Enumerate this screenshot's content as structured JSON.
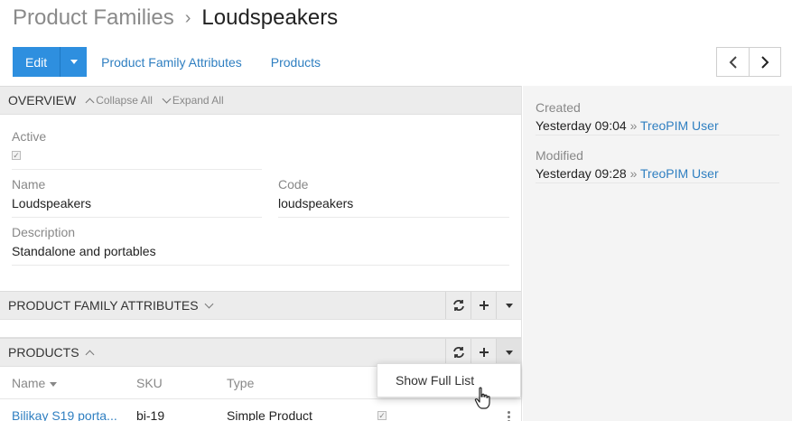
{
  "breadcrumb": {
    "parent": "Product Families",
    "separator": "›",
    "current": "Loudspeakers"
  },
  "toolbar": {
    "edit_label": "Edit",
    "links": [
      "Product Family Attributes",
      "Products"
    ]
  },
  "overview": {
    "title": "OVERVIEW",
    "collapse_all": "Collapse All",
    "expand_all": "Expand All",
    "active_label": "Active",
    "active_checked": true,
    "name_label": "Name",
    "name_value": "Loudspeakers",
    "code_label": "Code",
    "code_value": "loudspeakers",
    "description_label": "Description",
    "description_value": "Standalone and portables"
  },
  "family_attributes_panel": {
    "title": "PRODUCT FAMILY ATTRIBUTES"
  },
  "products_panel": {
    "title": "PRODUCTS",
    "columns": {
      "name": "Name",
      "sku": "SKU",
      "type": "Type"
    },
    "rows": [
      {
        "name": "Bilikay S19 porta...",
        "sku": "bi-19",
        "type": "Simple Product",
        "checked": true
      }
    ],
    "dropdown": {
      "show_full_list": "Show Full List"
    }
  },
  "side": {
    "created_label": "Created",
    "created_time": "Yesterday 09:04",
    "created_user": "TreoPIM User",
    "modified_label": "Modified",
    "modified_time": "Yesterday 09:28",
    "modified_user": "TreoPIM User",
    "separator": "»"
  },
  "colors": {
    "primary": "#2e8fdf",
    "link": "#2f7fc1",
    "panel_header": "#ececec",
    "side_bg": "#f4f4f4"
  }
}
